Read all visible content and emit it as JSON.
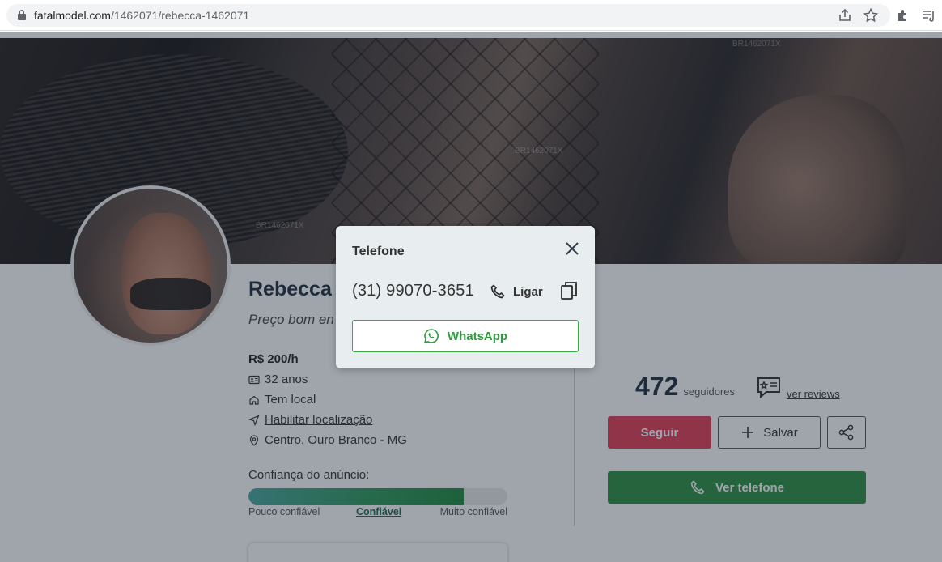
{
  "browser": {
    "url_host": "fatalmodel.com",
    "url_path": "/1462071/rebecca-1462071"
  },
  "profile": {
    "watermark": "BR1462071X",
    "name": "Rebecca",
    "tagline": "Preço bom en",
    "price": "R$ 200/h",
    "age": "32 anos",
    "location_type": "Tem local",
    "enable_location": "Habilitar localização",
    "address": "Centro, Ouro Branco - MG",
    "trust": {
      "label": "Confiança do anúncio:",
      "level": 0.83,
      "low": "Pouco confiável",
      "mid": "Confiável",
      "high": "Muito confiável"
    },
    "followers_count": "472",
    "followers_label": "seguidores",
    "reviews_link": "ver reviews",
    "follow_button": "Seguir",
    "save_button": "Salvar",
    "phone_button": "Ver telefone"
  },
  "modal": {
    "title": "Telefone",
    "phone": "(31) 99070-3651",
    "call_label": "Ligar",
    "whatsapp_label": "WhatsApp"
  },
  "colors": {
    "follow": "#e23d55",
    "phone_button": "#2e8f43",
    "whatsapp": "#2e9a3c",
    "overlay": "#1d283a"
  },
  "icons": [
    "lock-icon",
    "share-page-icon",
    "star-icon",
    "extensions-icon",
    "reading-list-icon",
    "id-card-icon",
    "home-icon",
    "navigation-icon",
    "map-pin-icon",
    "reviews-icon",
    "plus-icon",
    "share-icon",
    "phone-icon",
    "close-icon",
    "copy-icon",
    "whatsapp-icon"
  ]
}
